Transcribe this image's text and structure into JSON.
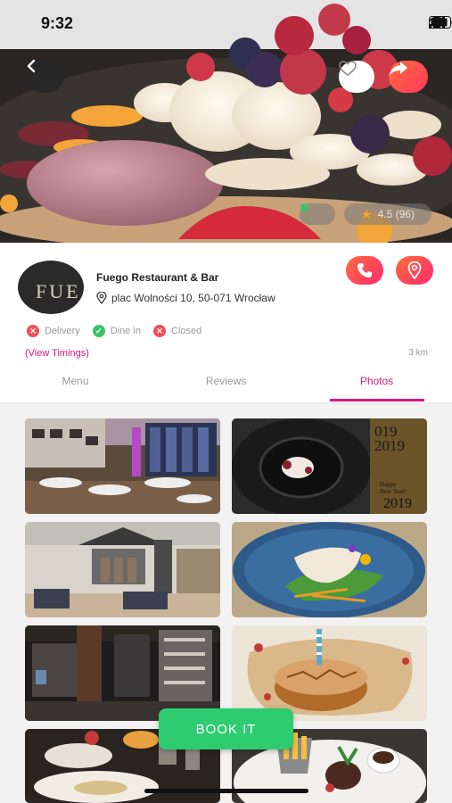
{
  "status_bar": {
    "time": "9:32"
  },
  "hero": {
    "back_icon": "chevron-left-icon",
    "favorite_icon": "heart-icon",
    "share_icon": "share-arrow-icon",
    "rating": "4.5 (96)",
    "rating_icon": "star-icon"
  },
  "restaurant": {
    "logo_text": "FUE",
    "name": "Fuego Restaurant & Bar",
    "address": "plac Wolności 10, 50-071 Wrocław"
  },
  "services": [
    {
      "label": "Delivery",
      "available": false
    },
    {
      "label": "Dine in",
      "available": true
    },
    {
      "label": "Closed",
      "available": false
    }
  ],
  "timings_link": "(View Timings)",
  "distance": "3 km",
  "tabs": [
    {
      "label": "Menu",
      "active": false
    },
    {
      "label": "Reviews",
      "active": false
    },
    {
      "label": "Photos",
      "active": true
    }
  ],
  "photo_overlay": {
    "year_top": "019",
    "year_mid": "2019",
    "happy": "Happy",
    "new_year": "New Year!",
    "year_bottom": "2019"
  },
  "book_button": "BOOK IT",
  "colors": {
    "accent": "#d6197a",
    "cta": "#2ecc71",
    "action_gradient_start": "#ff6a3d",
    "action_gradient_end": "#ff2d6e"
  }
}
